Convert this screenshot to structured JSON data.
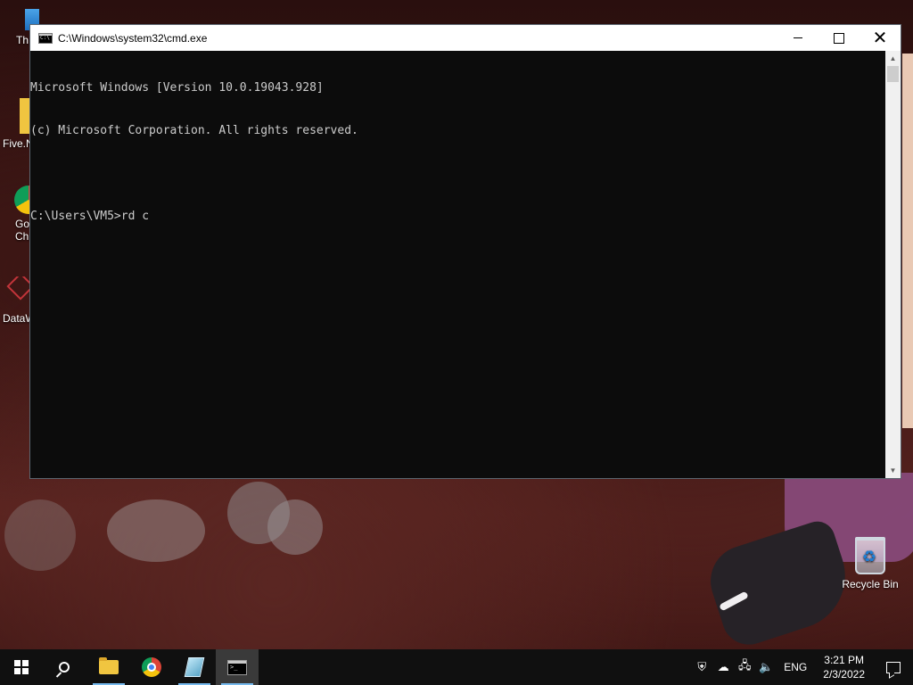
{
  "desktop": {
    "left_icons": [
      {
        "label": "Th",
        "icon": "this-pc-icon"
      },
      {
        "label": "Five.N",
        "icon": "folder-icon"
      },
      {
        "label": "Go Chr",
        "icon": "chrome-shortcut-icon"
      },
      {
        "label": "DataW",
        "icon": "datawrapper-shortcut-icon"
      }
    ],
    "recycle_bin": {
      "label": "Recycle Bin",
      "icon": "recycle-bin-icon"
    }
  },
  "window": {
    "title": "C:\\Windows\\system32\\cmd.exe",
    "icon": "cmd-icon",
    "buttons": {
      "minimize": "minimize",
      "maximize": "maximize",
      "close": "✕"
    }
  },
  "console": {
    "lines": [
      "Microsoft Windows [Version 10.0.19043.928]",
      "(c) Microsoft Corporation. All rights reserved.",
      "",
      "C:\\Users\\VM5>rd c"
    ],
    "text_color": "#cccccc",
    "background": "#0c0c0c"
  },
  "taskbar": {
    "items": [
      {
        "name": "start",
        "icon": "windows-start-icon"
      },
      {
        "name": "search",
        "icon": "search-icon"
      },
      {
        "name": "file-explorer",
        "icon": "folder-icon"
      },
      {
        "name": "chrome",
        "icon": "chrome-icon"
      },
      {
        "name": "tool",
        "icon": "app-icon"
      },
      {
        "name": "cmd",
        "icon": "cmd-icon",
        "active": true
      }
    ],
    "tray": {
      "language": "ENG",
      "time": "3:21 PM",
      "date": "2/3/2022"
    }
  }
}
